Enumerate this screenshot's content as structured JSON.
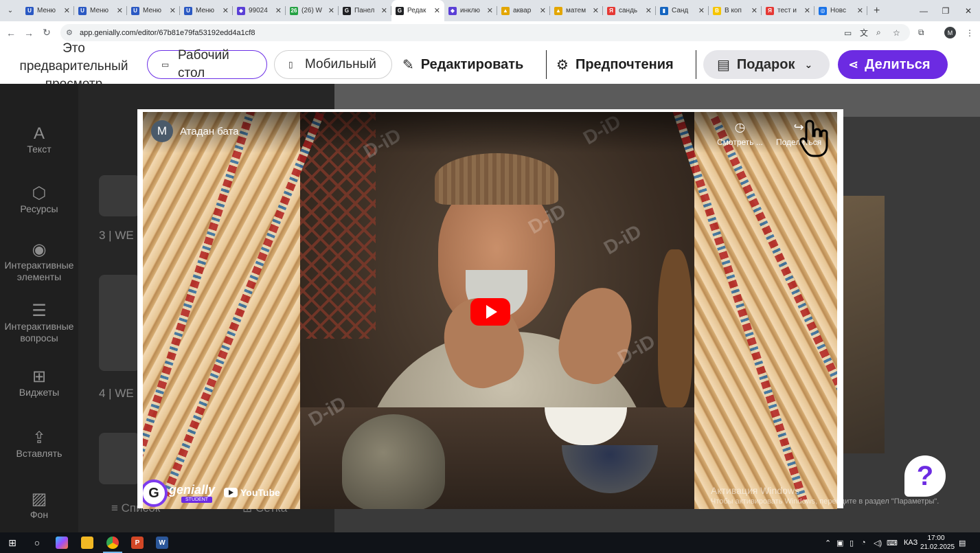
{
  "browser": {
    "tabs": [
      {
        "title": "Меню",
        "fav_color": "#2b59c3",
        "fav_glyph": "U"
      },
      {
        "title": "Меню",
        "fav_color": "#2b59c3",
        "fav_glyph": "U"
      },
      {
        "title": "Меню",
        "fav_color": "#2b59c3",
        "fav_glyph": "U"
      },
      {
        "title": "Меню",
        "fav_color": "#2b59c3",
        "fav_glyph": "U"
      },
      {
        "title": "99024",
        "fav_color": "#5a3fd6",
        "fav_glyph": "◆"
      },
      {
        "title": "(26) W",
        "fav_color": "#25a244",
        "fav_glyph": "26"
      },
      {
        "title": "Панел",
        "fav_color": "#202124",
        "fav_glyph": "G"
      },
      {
        "title": "Редак",
        "fav_color": "#202124",
        "fav_glyph": "G",
        "active": true
      },
      {
        "title": "инклю",
        "fav_color": "#5a3fd6",
        "fav_glyph": "◆"
      },
      {
        "title": "аквар",
        "fav_color": "#e3a600",
        "fav_glyph": "▲"
      },
      {
        "title": "матем",
        "fav_color": "#e3a600",
        "fav_glyph": "▲"
      },
      {
        "title": "сандь",
        "fav_color": "#e53935",
        "fav_glyph": "Я"
      },
      {
        "title": "Санд",
        "fav_color": "#1565c0",
        "fav_glyph": "▮"
      },
      {
        "title": "В коп",
        "fav_color": "#f6c500",
        "fav_glyph": "В"
      },
      {
        "title": "тест и",
        "fav_color": "#e53935",
        "fav_glyph": "Я"
      },
      {
        "title": "Новс",
        "fav_color": "#1a73e8",
        "fav_glyph": "◎"
      }
    ],
    "url": "app.genially.com/editor/67b81e79fa53192edd4a1cf8",
    "avatar_letter": "M"
  },
  "toolbar": {
    "preview_label": "Это предварительный просмотр",
    "desktop_label": "Рабочий стол",
    "mobile_label": "Мобильный",
    "edit_label": "Редактировать",
    "prefs_label": "Предпочтения",
    "gift_label": "Подарок",
    "share_label": "Делиться"
  },
  "left_rail": [
    {
      "label": "Текст",
      "icon": "text-icon"
    },
    {
      "label": "Ресурсы",
      "icon": "resources-icon"
    },
    {
      "label": "Интерактивные элементы",
      "icon": "interactive-elements-icon"
    },
    {
      "label": "Интерактивные вопросы",
      "icon": "interactive-questions-icon"
    },
    {
      "label": "Виджеты",
      "icon": "widgets-icon"
    },
    {
      "label": "Вставлять",
      "icon": "insert-icon"
    },
    {
      "label": "Фон",
      "icon": "background-icon"
    }
  ],
  "panel": {
    "slide3_label": "3 |  WE",
    "slide4_label": "4 |  WE",
    "list_tab": "Список",
    "grid_tab": "Сетка"
  },
  "video": {
    "channel_letter": "M",
    "title": "Атадан бата",
    "watch_later": "Смотреть ...",
    "share": "Поделиться",
    "brand": "genially",
    "brand_badge": "STUDENT",
    "youtube": "YouTube"
  },
  "windows_activation": {
    "title": "Активация Windows",
    "subtitle": "Чтобы активировать Windows, перейдите в раздел \"Параметры\"."
  },
  "taskbar": {
    "lang": "КАЗ",
    "time": "17:00",
    "date": "21.02.2025"
  }
}
